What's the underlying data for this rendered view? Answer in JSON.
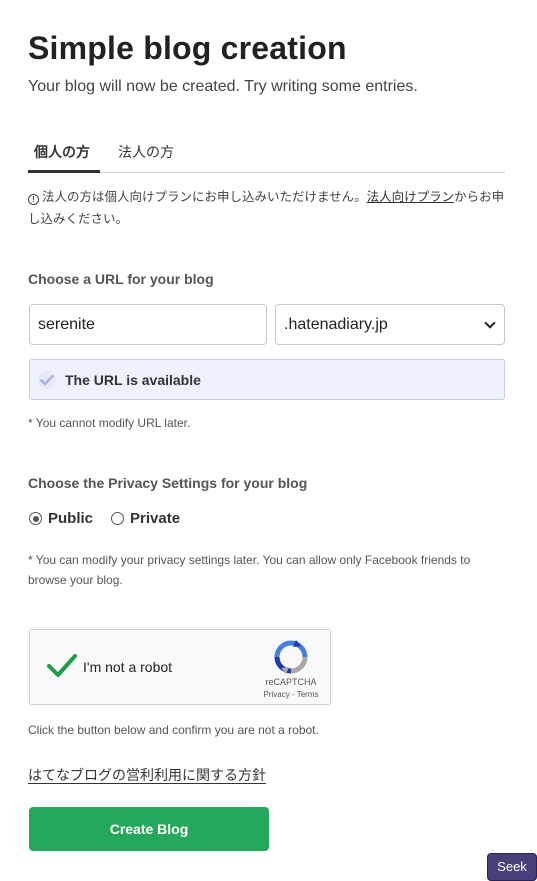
{
  "header": {
    "title": "Simple blog creation",
    "subtitle": "Your blog will now be created. Try writing some entries."
  },
  "tabs": [
    {
      "label": "個人の方",
      "active": true
    },
    {
      "label": "法人の方",
      "active": false
    }
  ],
  "notice": {
    "icon": "info-icon",
    "text_before": "法人の方は個人向けプランにお申し込みいただけません。",
    "link_text": "法人向けプラン",
    "text_after": "からお申し込みください。"
  },
  "url_section": {
    "label": "Choose a URL for your blog",
    "subdomain_value": "serenite",
    "domain_selected": ".hatenadiary.jp",
    "availability_text": "The URL is available",
    "note": "* You cannot modify URL later."
  },
  "privacy_section": {
    "label": "Choose the Privacy Settings for your blog",
    "options": [
      {
        "label": "Public",
        "checked": true
      },
      {
        "label": "Private",
        "checked": false
      }
    ],
    "note": "* You can modify your privacy settings later. You can allow only Facebook friends to browse your blog."
  },
  "captcha": {
    "label": "I'm not a robot",
    "brand": "reCAPTCHA",
    "links": "Privacy - Terms",
    "checked": true,
    "note": "Click the button below and confirm you are not a robot."
  },
  "policy_link": "はてなブログの営利利用に関する方針",
  "create_button": "Create Blog",
  "seek_button": "Seek",
  "colors": {
    "primary_button": "#25a85c",
    "availability_bg": "#eef2fe",
    "captcha_check": "#1a9e4a",
    "seek_bg": "#4b3f7a"
  }
}
